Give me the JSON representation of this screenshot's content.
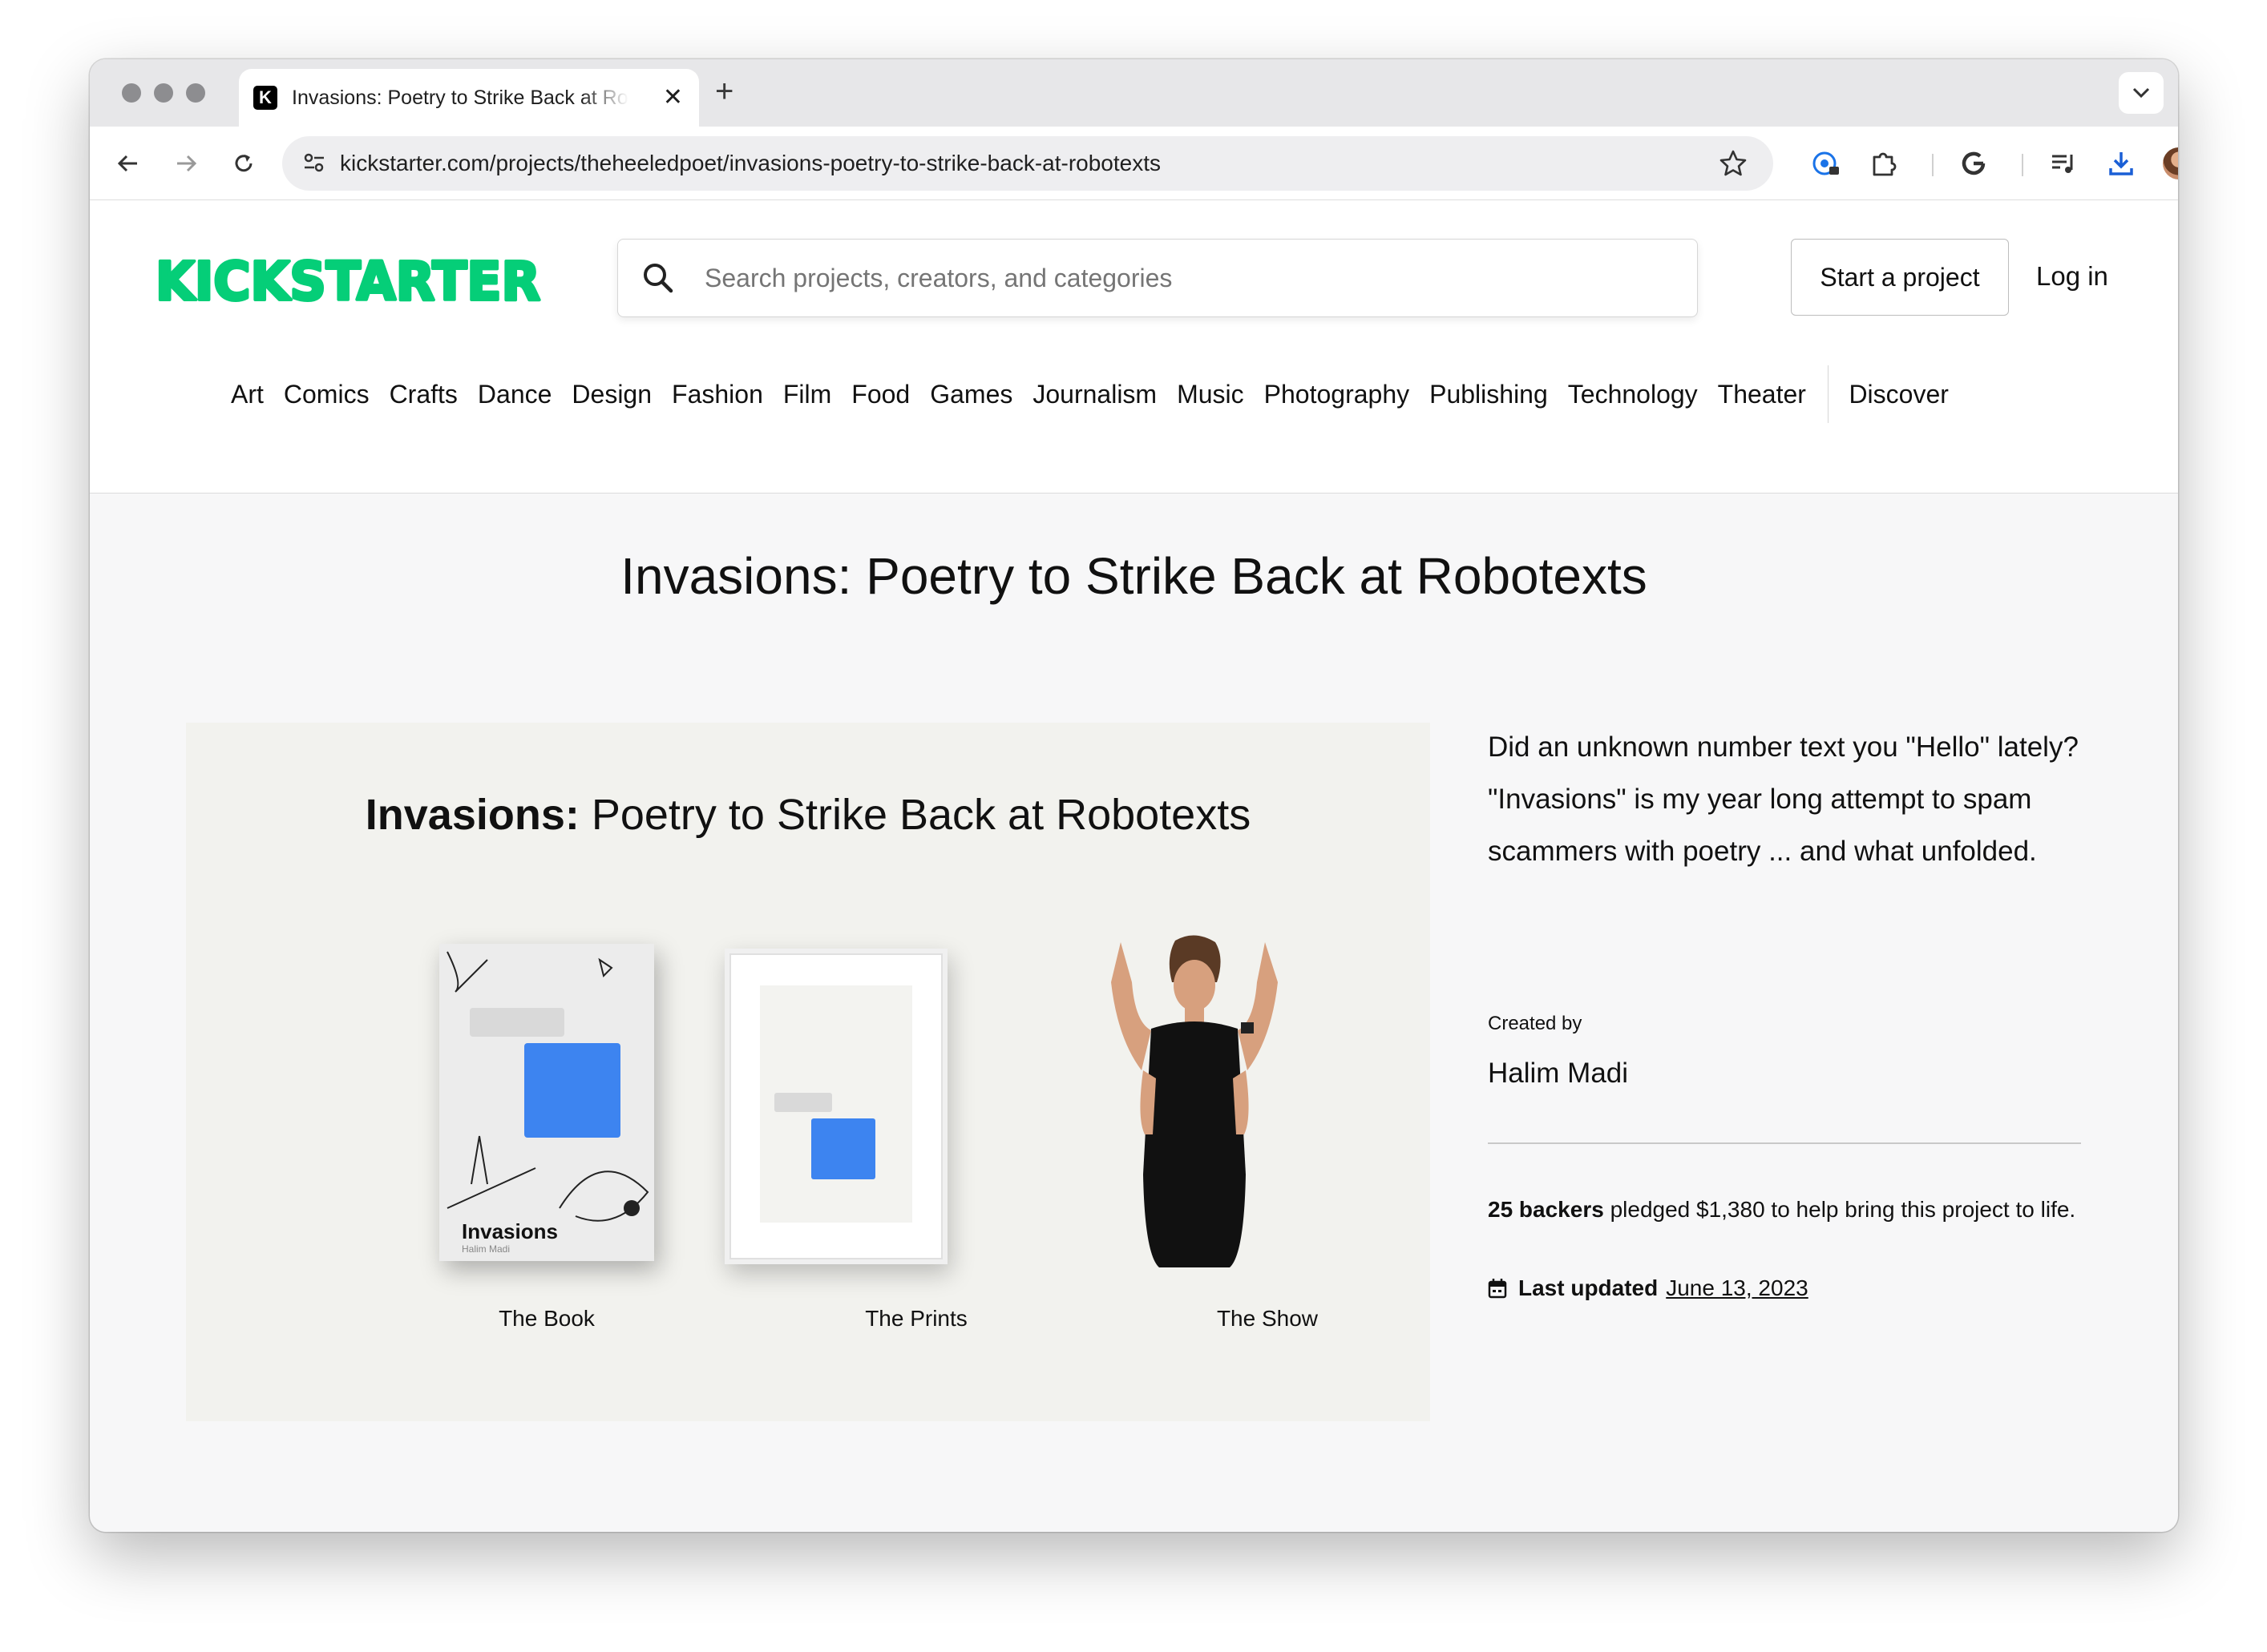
{
  "browser": {
    "tab_title": "Invasions: Poetry to Strike Back at Robotexts",
    "url": "kickstarter.com/projects/theheeledpoet/invasions-poetry-to-strike-back-at-robotexts"
  },
  "header": {
    "logo_text": "KICKSTARTER",
    "logo_color": "#05ce78",
    "search_placeholder": "Search projects, creators, and categories",
    "start_project": "Start a project",
    "log_in": "Log in",
    "categories": [
      "Art",
      "Comics",
      "Crafts",
      "Dance",
      "Design",
      "Fashion",
      "Film",
      "Food",
      "Games",
      "Journalism",
      "Music",
      "Photography",
      "Publishing",
      "Technology",
      "Theater"
    ],
    "discover": "Discover"
  },
  "project": {
    "title": "Invasions: Poetry to Strike Back at Robotexts",
    "hero": {
      "title_bold": "Invasions:",
      "title_rest": " Poetry to Strike Back at Robotexts",
      "book_title": "Invasions",
      "book_author": "Halim Madi",
      "items": [
        {
          "caption": "The Book"
        },
        {
          "caption": "The Prints"
        },
        {
          "caption": "The Show"
        }
      ]
    },
    "blurb": "Did an unknown number text you \"Hello\" lately? \"Invasions\" is my year long attempt to spam scammers with poetry ... and what unfolded.",
    "created_by_label": "Created by",
    "creator": "Halim Madi",
    "backers_count": "25 backers",
    "backers_rest": " pledged $1,380 to help bring this project to life.",
    "last_updated_label": "Last updated",
    "last_updated_date": "June 13, 2023"
  }
}
